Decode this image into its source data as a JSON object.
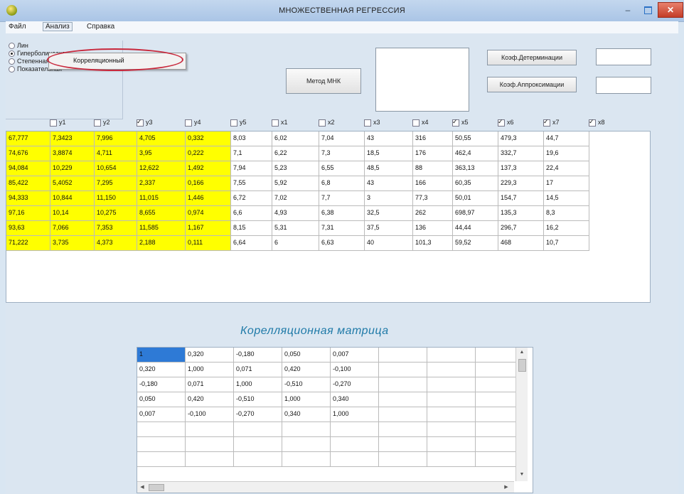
{
  "window": {
    "title": "МНОЖЕСТВЕННАЯ РЕГРЕССИЯ",
    "minimize_glyph": "–",
    "close_glyph": "✕"
  },
  "menu": {
    "file": "Файл",
    "analysis": "Анализ",
    "help": "Справка",
    "dropdown_item": "Корреляционный"
  },
  "regression_types": [
    {
      "label": "Лин",
      "selected": false
    },
    {
      "label": "Гиперболическая",
      "selected": true
    },
    {
      "label": "Степенная",
      "selected": false
    },
    {
      "label": "Показательная",
      "selected": false
    }
  ],
  "buttons": {
    "mnk": "Метод МНК",
    "det_coef": "Коэф.Детерминации",
    "approx_coef": "Коэф.Аппроксимации"
  },
  "checkboxes": [
    {
      "label": "y1",
      "checked": false
    },
    {
      "label": "y2",
      "checked": false
    },
    {
      "label": "y3",
      "checked": true
    },
    {
      "label": "y4",
      "checked": false
    },
    {
      "label": "y5",
      "checked": false
    },
    {
      "label": "x1",
      "checked": false
    },
    {
      "label": "x2",
      "checked": false
    },
    {
      "label": "x3",
      "checked": false
    },
    {
      "label": "x4",
      "checked": false
    },
    {
      "label": "x5",
      "checked": true
    },
    {
      "label": "x6",
      "checked": true
    },
    {
      "label": "x7",
      "checked": true
    },
    {
      "label": "x8",
      "checked": true
    }
  ],
  "data_table": {
    "rows": [
      [
        "67,777",
        "7,3423",
        "7,996",
        "4,705",
        "0,332",
        "8,03",
        "6,02",
        "7,04",
        "43",
        "316",
        "50,55",
        "479,3",
        "44,7"
      ],
      [
        "74,676",
        "3,8874",
        "4,711",
        "3,95",
        "0,222",
        "7,1",
        "6,22",
        "7,3",
        "18,5",
        "176",
        "462,4",
        "332,7",
        "19,6"
      ],
      [
        "94,084",
        "10,229",
        "10,654",
        "12,622",
        "1,492",
        "7,94",
        "5,23",
        "6,55",
        "48,5",
        "88",
        "363,13",
        "137,3",
        "22,4"
      ],
      [
        "85,422",
        "5,4052",
        "7,295",
        "2,337",
        "0,166",
        "7,55",
        "5,92",
        "6,8",
        "43",
        "166",
        "60,35",
        "229,3",
        "17"
      ],
      [
        "94,333",
        "10,844",
        "11,150",
        "11,015",
        "1,446",
        "6,72",
        "7,02",
        "7,7",
        "3",
        "77,3",
        "50,01",
        "154,7",
        "14,5"
      ],
      [
        "97,16",
        "10,14",
        "10,275",
        "8,655",
        "0,974",
        "6,6",
        "4,93",
        "6,38",
        "32,5",
        "262",
        "698,97",
        "135,3",
        "8,3"
      ],
      [
        "93,63",
        "7,066",
        "7,353",
        "11,585",
        "1,167",
        "8,15",
        "5,31",
        "7,31",
        "37,5",
        "136",
        "44,44",
        "296,7",
        "16,2"
      ],
      [
        "71,222",
        "3,735",
        "4,373",
        "2,188",
        "0,111",
        "6,64",
        "6",
        "6,63",
        "40",
        "101,3",
        "59,52",
        "468",
        "10,7"
      ]
    ]
  },
  "correlation": {
    "title": "Корелляционная матрица",
    "rows": [
      [
        "1",
        "0,320",
        "-0,180",
        "0,050",
        "0,007"
      ],
      [
        "0,320",
        "1,000",
        "0,071",
        "0,420",
        "-0,100"
      ],
      [
        "-0,180",
        "0,071",
        "1,000",
        "-0,510",
        "-0,270"
      ],
      [
        "0,050",
        "0,420",
        "-0,510",
        "1,000",
        "0,340"
      ],
      [
        "0,007",
        "-0,100",
        "-0,270",
        "0,340",
        "1,000"
      ],
      [
        "",
        "",
        "",
        "",
        ""
      ],
      [
        "",
        "",
        "",
        "",
        ""
      ],
      [
        "",
        "",
        "",
        "",
        ""
      ]
    ]
  },
  "colors": {
    "highlight_yellow": "#ffff00",
    "selection_blue": "#2e7ad6",
    "ellipse_red": "#c8283c",
    "title_teal": "#1f7aa8"
  }
}
